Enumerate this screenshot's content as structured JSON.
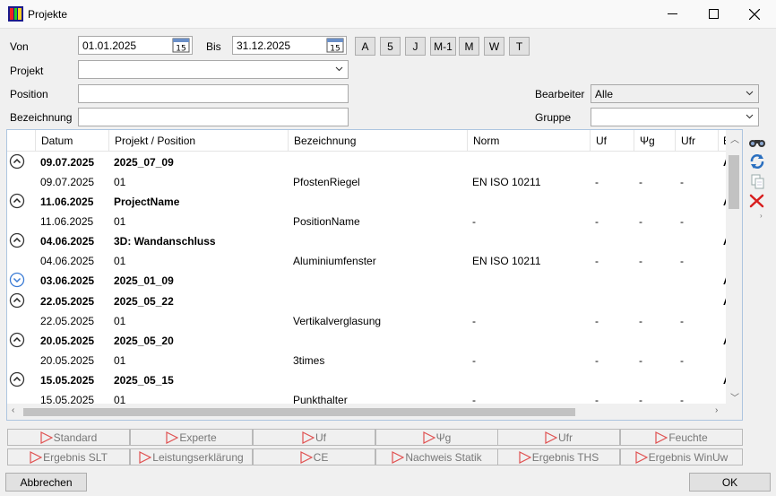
{
  "window": {
    "title": "Projekte",
    "minimize_icon": "minimize-icon",
    "maximize_icon": "maximize-icon",
    "close_icon": "close-icon"
  },
  "filters": {
    "von_label": "Von",
    "von_value": "01.01.2025",
    "bis_label": "Bis",
    "bis_value": "31.12.2025",
    "calendar_day": "15",
    "quick_buttons": [
      "A",
      "5",
      "J",
      "M-1",
      "M",
      "W",
      "T"
    ],
    "projekt_label": "Projekt",
    "projekt_value": "",
    "position_label": "Position",
    "position_value": "",
    "bezeichnung_label": "Bezeichnung",
    "bezeichnung_value": "",
    "bearbeiter_label": "Bearbeiter",
    "bearbeiter_value": "Alle",
    "gruppe_label": "Gruppe",
    "gruppe_value": ""
  },
  "grid": {
    "columns": [
      "Datum",
      "Projekt / Position",
      "Bezeichnung",
      "Norm",
      "Uf",
      "Ψg",
      "Ufr",
      "E"
    ],
    "rows": [
      {
        "type": "group",
        "expanded": true,
        "datum": "09.07.2025",
        "projekt": "2025_07_09",
        "extra": "A"
      },
      {
        "type": "item",
        "datum": "09.07.2025",
        "projekt": "01",
        "bezeichnung": "PfostenRiegel",
        "norm": "EN ISO 10211",
        "uf": "-",
        "psig": "-",
        "ufr": "-"
      },
      {
        "type": "group",
        "expanded": true,
        "datum": "11.06.2025",
        "projekt": "ProjectName",
        "extra": "A"
      },
      {
        "type": "item",
        "datum": "11.06.2025",
        "projekt": "01",
        "bezeichnung": "PositionName",
        "norm": "-",
        "uf": "-",
        "psig": "-",
        "ufr": "-"
      },
      {
        "type": "group",
        "expanded": true,
        "datum": "04.06.2025",
        "projekt": "3D: Wandanschluss",
        "extra": "A"
      },
      {
        "type": "item",
        "datum": "04.06.2025",
        "projekt": "01",
        "bezeichnung": "Aluminiumfenster",
        "norm": "EN ISO 10211",
        "uf": "-",
        "psig": "-",
        "ufr": "-"
      },
      {
        "type": "group",
        "expanded": false,
        "datum": "03.06.2025",
        "projekt": "2025_01_09",
        "extra": "A"
      },
      {
        "type": "group",
        "expanded": true,
        "datum": "22.05.2025",
        "projekt": "2025_05_22",
        "extra": "A"
      },
      {
        "type": "item",
        "datum": "22.05.2025",
        "projekt": "01",
        "bezeichnung": "Vertikalverglasung",
        "norm": "-",
        "uf": "-",
        "psig": "-",
        "ufr": "-"
      },
      {
        "type": "group",
        "expanded": true,
        "datum": "20.05.2025",
        "projekt": "2025_05_20",
        "extra": "A"
      },
      {
        "type": "item",
        "datum": "20.05.2025",
        "projekt": "01",
        "bezeichnung": "3times",
        "norm": "-",
        "uf": "-",
        "psig": "-",
        "ufr": "-"
      },
      {
        "type": "group",
        "expanded": true,
        "datum": "15.05.2025",
        "projekt": "2025_05_15",
        "extra": "A"
      },
      {
        "type": "item",
        "datum": "15.05.2025",
        "projekt": "01",
        "bezeichnung": "Punkthalter",
        "norm": "-",
        "uf": "-",
        "psig": "-",
        "ufr": "-"
      }
    ]
  },
  "side_tools": [
    "binoculars-icon",
    "refresh-icon",
    "copy-icon",
    "delete-icon"
  ],
  "report_buttons_row1": [
    "Standard",
    "Experte",
    "Uf",
    "Ψg",
    "Ufr",
    "Feuchte"
  ],
  "report_buttons_row2": [
    "Ergebnis SLT",
    "Leistungserklärung",
    "CE",
    "Nachweis Statik",
    "Ergebnis THS",
    "Ergebnis WinUw"
  ],
  "footer": {
    "cancel_label": "Abbrechen",
    "ok_label": "OK"
  }
}
